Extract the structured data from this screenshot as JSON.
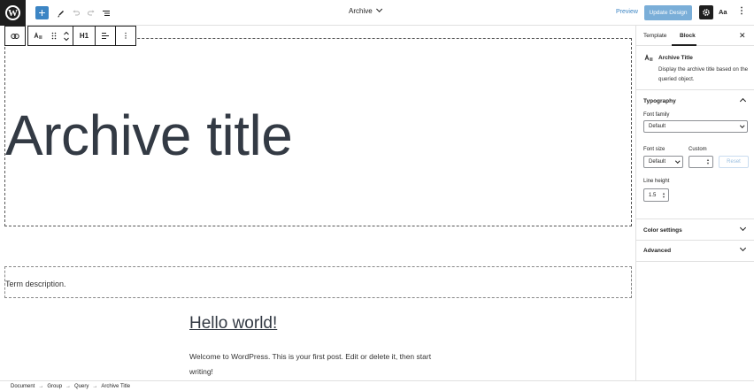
{
  "topbar": {
    "logo_letter": "W",
    "add_icon": "+",
    "doc_title": "Archive",
    "preview_label": "Preview",
    "update_label": "Update Design",
    "styles_label": "Aa",
    "icons": [
      "plus-icon",
      "pencil-icon",
      "undo-icon",
      "redo-icon",
      "list-view-icon",
      "gear-icon",
      "kebab-icon"
    ]
  },
  "block_toolbar": {
    "heading_level": "H1"
  },
  "canvas": {
    "archive_title": "Archive title",
    "term_description": "Term description.",
    "post_title": "Hello world!",
    "post_excerpt": "Welcome to WordPress. This is your first post. Edit or delete it, then start writing!"
  },
  "sidebar": {
    "tabs": [
      {
        "label": "Template",
        "active": false
      },
      {
        "label": "Block",
        "active": true
      }
    ],
    "block": {
      "title": "Archive Title",
      "description": "Display the archive title based on the queried object."
    },
    "typography": {
      "title": "Typography",
      "font_family_label": "Font family",
      "font_family_value": "Default",
      "font_size_label": "Font size",
      "font_size_value": "Default",
      "custom_label": "Custom",
      "reset_label": "Reset",
      "line_height_label": "Line height",
      "line_height_value": "1.5"
    },
    "color_settings_label": "Color settings",
    "advanced_label": "Advanced"
  },
  "breadcrumb": [
    "Document",
    "Group",
    "Query",
    "Archive Title"
  ],
  "colors": {
    "accent": "#3c85c4",
    "update_button": "#7aaed8",
    "dark": "#1e1e1e"
  }
}
